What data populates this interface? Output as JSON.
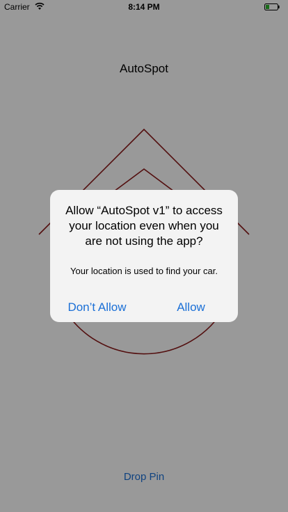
{
  "status_bar": {
    "carrier": "Carrier",
    "time": "8:14 PM"
  },
  "nav": {
    "title": "AutoSpot"
  },
  "main": {
    "drop_pin_label": "Drop Pin"
  },
  "alert": {
    "title": "Allow “AutoSpot v1” to access your location even when you are not using the app?",
    "message": "Your location is used to find your car.",
    "deny_label": "Don’t Allow",
    "allow_label": "Allow"
  },
  "colors": {
    "accent": "#1a6fd6",
    "logo_stroke": "#8b1a1a",
    "alert_background": "#f3f3f3"
  },
  "icons": {
    "wifi": "wifi-icon",
    "battery": "battery-icon",
    "logo": "logo-roof-circle-icon"
  }
}
